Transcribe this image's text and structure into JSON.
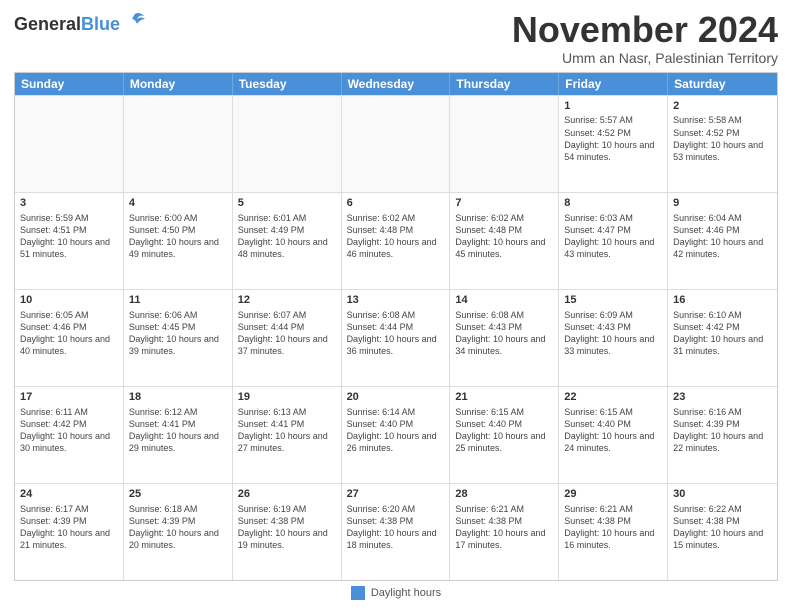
{
  "header": {
    "logo_general": "General",
    "logo_blue": "Blue",
    "main_title": "November 2024",
    "subtitle": "Umm an Nasr, Palestinian Territory"
  },
  "calendar": {
    "days_of_week": [
      "Sunday",
      "Monday",
      "Tuesday",
      "Wednesday",
      "Thursday",
      "Friday",
      "Saturday"
    ],
    "rows": [
      [
        {
          "day": "",
          "info": "",
          "empty": true
        },
        {
          "day": "",
          "info": "",
          "empty": true
        },
        {
          "day": "",
          "info": "",
          "empty": true
        },
        {
          "day": "",
          "info": "",
          "empty": true
        },
        {
          "day": "",
          "info": "",
          "empty": true
        },
        {
          "day": "1",
          "info": "Sunrise: 5:57 AM\nSunset: 4:52 PM\nDaylight: 10 hours and 54 minutes.",
          "empty": false
        },
        {
          "day": "2",
          "info": "Sunrise: 5:58 AM\nSunset: 4:52 PM\nDaylight: 10 hours and 53 minutes.",
          "empty": false
        }
      ],
      [
        {
          "day": "3",
          "info": "Sunrise: 5:59 AM\nSunset: 4:51 PM\nDaylight: 10 hours and 51 minutes.",
          "empty": false
        },
        {
          "day": "4",
          "info": "Sunrise: 6:00 AM\nSunset: 4:50 PM\nDaylight: 10 hours and 49 minutes.",
          "empty": false
        },
        {
          "day": "5",
          "info": "Sunrise: 6:01 AM\nSunset: 4:49 PM\nDaylight: 10 hours and 48 minutes.",
          "empty": false
        },
        {
          "day": "6",
          "info": "Sunrise: 6:02 AM\nSunset: 4:48 PM\nDaylight: 10 hours and 46 minutes.",
          "empty": false
        },
        {
          "day": "7",
          "info": "Sunrise: 6:02 AM\nSunset: 4:48 PM\nDaylight: 10 hours and 45 minutes.",
          "empty": false
        },
        {
          "day": "8",
          "info": "Sunrise: 6:03 AM\nSunset: 4:47 PM\nDaylight: 10 hours and 43 minutes.",
          "empty": false
        },
        {
          "day": "9",
          "info": "Sunrise: 6:04 AM\nSunset: 4:46 PM\nDaylight: 10 hours and 42 minutes.",
          "empty": false
        }
      ],
      [
        {
          "day": "10",
          "info": "Sunrise: 6:05 AM\nSunset: 4:46 PM\nDaylight: 10 hours and 40 minutes.",
          "empty": false
        },
        {
          "day": "11",
          "info": "Sunrise: 6:06 AM\nSunset: 4:45 PM\nDaylight: 10 hours and 39 minutes.",
          "empty": false
        },
        {
          "day": "12",
          "info": "Sunrise: 6:07 AM\nSunset: 4:44 PM\nDaylight: 10 hours and 37 minutes.",
          "empty": false
        },
        {
          "day": "13",
          "info": "Sunrise: 6:08 AM\nSunset: 4:44 PM\nDaylight: 10 hours and 36 minutes.",
          "empty": false
        },
        {
          "day": "14",
          "info": "Sunrise: 6:08 AM\nSunset: 4:43 PM\nDaylight: 10 hours and 34 minutes.",
          "empty": false
        },
        {
          "day": "15",
          "info": "Sunrise: 6:09 AM\nSunset: 4:43 PM\nDaylight: 10 hours and 33 minutes.",
          "empty": false
        },
        {
          "day": "16",
          "info": "Sunrise: 6:10 AM\nSunset: 4:42 PM\nDaylight: 10 hours and 31 minutes.",
          "empty": false
        }
      ],
      [
        {
          "day": "17",
          "info": "Sunrise: 6:11 AM\nSunset: 4:42 PM\nDaylight: 10 hours and 30 minutes.",
          "empty": false
        },
        {
          "day": "18",
          "info": "Sunrise: 6:12 AM\nSunset: 4:41 PM\nDaylight: 10 hours and 29 minutes.",
          "empty": false
        },
        {
          "day": "19",
          "info": "Sunrise: 6:13 AM\nSunset: 4:41 PM\nDaylight: 10 hours and 27 minutes.",
          "empty": false
        },
        {
          "day": "20",
          "info": "Sunrise: 6:14 AM\nSunset: 4:40 PM\nDaylight: 10 hours and 26 minutes.",
          "empty": false
        },
        {
          "day": "21",
          "info": "Sunrise: 6:15 AM\nSunset: 4:40 PM\nDaylight: 10 hours and 25 minutes.",
          "empty": false
        },
        {
          "day": "22",
          "info": "Sunrise: 6:15 AM\nSunset: 4:40 PM\nDaylight: 10 hours and 24 minutes.",
          "empty": false
        },
        {
          "day": "23",
          "info": "Sunrise: 6:16 AM\nSunset: 4:39 PM\nDaylight: 10 hours and 22 minutes.",
          "empty": false
        }
      ],
      [
        {
          "day": "24",
          "info": "Sunrise: 6:17 AM\nSunset: 4:39 PM\nDaylight: 10 hours and 21 minutes.",
          "empty": false
        },
        {
          "day": "25",
          "info": "Sunrise: 6:18 AM\nSunset: 4:39 PM\nDaylight: 10 hours and 20 minutes.",
          "empty": false
        },
        {
          "day": "26",
          "info": "Sunrise: 6:19 AM\nSunset: 4:38 PM\nDaylight: 10 hours and 19 minutes.",
          "empty": false
        },
        {
          "day": "27",
          "info": "Sunrise: 6:20 AM\nSunset: 4:38 PM\nDaylight: 10 hours and 18 minutes.",
          "empty": false
        },
        {
          "day": "28",
          "info": "Sunrise: 6:21 AM\nSunset: 4:38 PM\nDaylight: 10 hours and 17 minutes.",
          "empty": false
        },
        {
          "day": "29",
          "info": "Sunrise: 6:21 AM\nSunset: 4:38 PM\nDaylight: 10 hours and 16 minutes.",
          "empty": false
        },
        {
          "day": "30",
          "info": "Sunrise: 6:22 AM\nSunset: 4:38 PM\nDaylight: 10 hours and 15 minutes.",
          "empty": false
        }
      ]
    ]
  },
  "footer": {
    "legend_label": "Daylight hours"
  }
}
